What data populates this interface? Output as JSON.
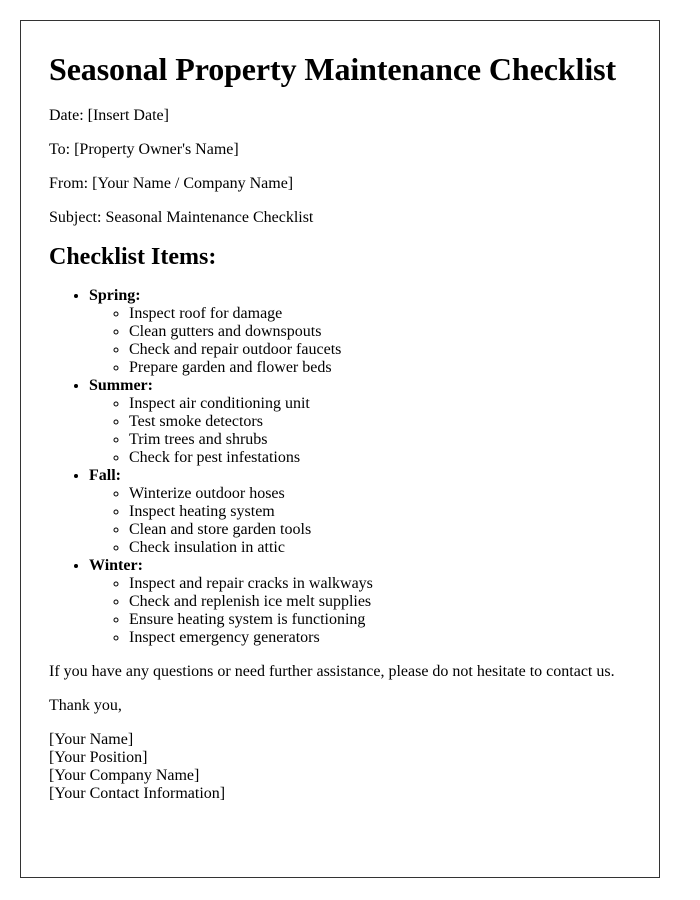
{
  "document": {
    "title": "Seasonal Property Maintenance Checklist",
    "meta": {
      "date": "Date: [Insert Date]",
      "to": "To: [Property Owner's Name]",
      "from": "From: [Your Name / Company Name]",
      "subject": "Subject: Seasonal Maintenance Checklist"
    },
    "section_heading": "Checklist Items:",
    "seasons": [
      {
        "label": "Spring:",
        "tasks": [
          "Inspect roof for damage",
          "Clean gutters and downspouts",
          "Check and repair outdoor faucets",
          "Prepare garden and flower beds"
        ]
      },
      {
        "label": "Summer:",
        "tasks": [
          "Inspect air conditioning unit",
          "Test smoke detectors",
          "Trim trees and shrubs",
          "Check for pest infestations"
        ]
      },
      {
        "label": "Fall:",
        "tasks": [
          "Winterize outdoor hoses",
          "Inspect heating system",
          "Clean and store garden tools",
          "Check insulation in attic"
        ]
      },
      {
        "label": "Winter:",
        "tasks": [
          "Inspect and repair cracks in walkways",
          "Check and replenish ice melt supplies",
          "Ensure heating system is functioning",
          "Inspect emergency generators"
        ]
      }
    ],
    "closing": "If you have any questions or need further assistance, please do not hesitate to contact us.",
    "thanks": "Thank you,",
    "signature": [
      "[Your Name]",
      "[Your Position]",
      "[Your Company Name]",
      "[Your Contact Information]"
    ]
  }
}
